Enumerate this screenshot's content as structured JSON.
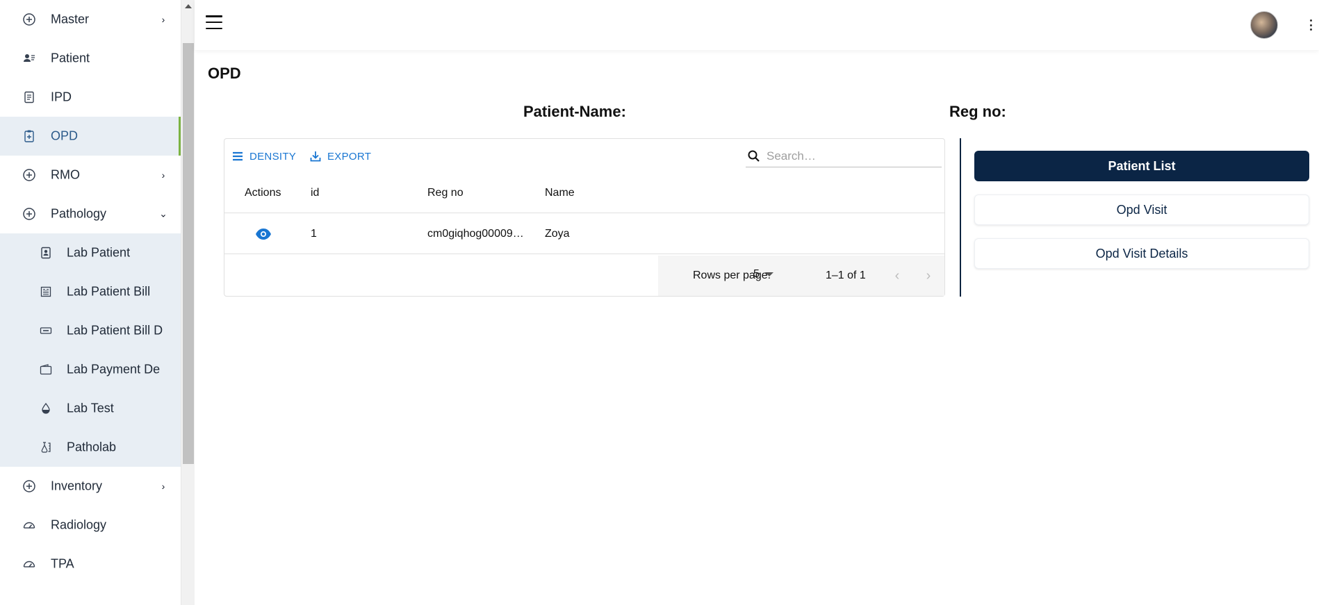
{
  "sidebar": {
    "items": [
      {
        "label": "Master",
        "icon": "plus-circle-icon",
        "chevron": "›"
      },
      {
        "label": "Patient",
        "icon": "patient-card-icon"
      },
      {
        "label": "IPD",
        "icon": "document-icon"
      },
      {
        "label": "OPD",
        "icon": "clipboard-plus-icon",
        "active": true
      },
      {
        "label": "RMO",
        "icon": "plus-circle-icon",
        "chevron": "›"
      },
      {
        "label": "Pathology",
        "icon": "plus-circle-icon",
        "chevron": "⌄"
      }
    ],
    "pathology_submenu": [
      {
        "label": "Lab Patient",
        "icon": "id-badge-icon"
      },
      {
        "label": "Lab Patient Bill",
        "icon": "receipt-icon"
      },
      {
        "label": "Lab Patient Bill D",
        "icon": "ticket-icon"
      },
      {
        "label": "Lab Payment De",
        "icon": "wallet-icon"
      },
      {
        "label": "Lab Test",
        "icon": "drop-icon"
      },
      {
        "label": "Patholab",
        "icon": "flask-icon"
      }
    ],
    "items_after": [
      {
        "label": "Inventory",
        "icon": "plus-circle-icon",
        "chevron": "›"
      },
      {
        "label": "Radiology",
        "icon": "gauge-icon"
      },
      {
        "label": "TPA",
        "icon": "gauge-icon"
      }
    ]
  },
  "header": {
    "menu_icon": "hamburger-icon",
    "avatar_icon": "user-avatar",
    "more_icon": "kebab-icon"
  },
  "page": {
    "title": "OPD",
    "patient_name_label": "Patient-Name:",
    "reg_no_label": "Reg no:"
  },
  "grid": {
    "toolbar": {
      "density_label": "DENSITY",
      "export_label": "EXPORT",
      "search_placeholder": "Search…"
    },
    "columns": [
      "Actions",
      "id",
      "Reg no",
      "Name"
    ],
    "rows": [
      {
        "id": "1",
        "reg_no": "cm0giqhog00009…",
        "name": "Zoya"
      }
    ],
    "footer": {
      "rows_per_page_label": "Rows per page:",
      "rows_per_page_value": "5",
      "range_text": "1–1 of 1",
      "prev_label": "‹",
      "next_label": "›"
    }
  },
  "right_panel": {
    "buttons": [
      "Patient List",
      "Opd Visit",
      "Opd Visit Details"
    ]
  },
  "colors": {
    "primary_dark": "#0b2545",
    "link_blue": "#1976d2",
    "active_bg": "#e8eef4",
    "active_indicator": "#7cb342"
  }
}
